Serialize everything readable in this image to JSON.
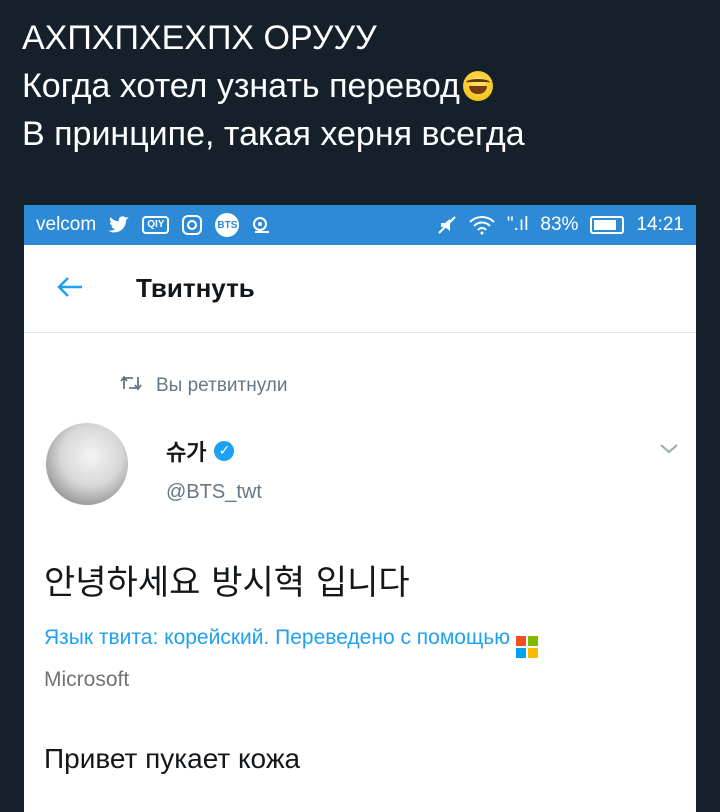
{
  "caption": {
    "line1": "АХПХПХЕХПХ ОРУУУ",
    "line2": "Когда хотел узнать перевод",
    "line3": "В принципе, такая херня всегда",
    "emoji_name": "tears-of-joy-emoji"
  },
  "status_bar": {
    "carrier": "velcom",
    "signal_text": "\".ıl",
    "battery": "83%",
    "time": "14:21",
    "bts_badge": "BTS",
    "box_badge": "QIY"
  },
  "header": {
    "back_icon": "back-arrow-icon",
    "title": "Твитнуть"
  },
  "tweet": {
    "retweet_label": "Вы ретвитнули",
    "author_name": "슈가",
    "author_handle": "@BTS_twt",
    "text": "안녕하세요 방시혁 입니다",
    "translation_notice": "Язык твита: корейский. Переведено с помощью",
    "translation_provider": "Microsoft",
    "translated_text": "Привет пукает кожа"
  },
  "colors": {
    "status_bar": "#2c8ad6",
    "accent": "#1da1f2",
    "page_bg": "#15202b"
  }
}
